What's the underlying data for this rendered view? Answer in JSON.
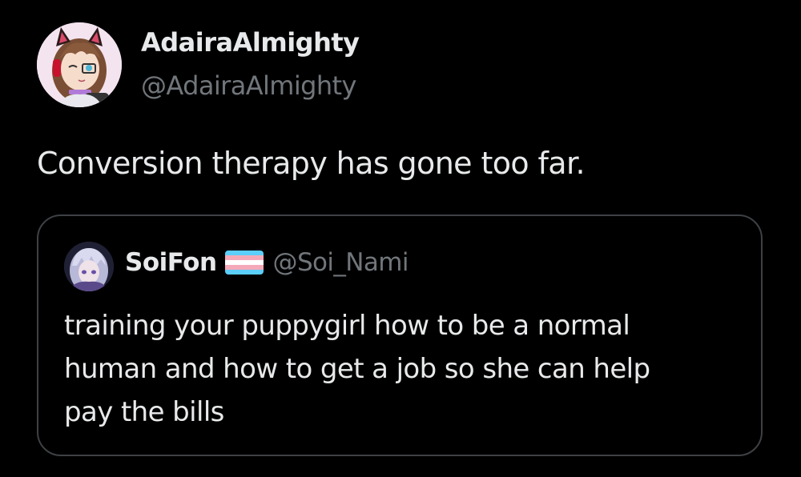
{
  "tweet": {
    "display_name": "AdairaAlmighty",
    "handle": "@AdairaAlmighty",
    "avatar_icon": "anime-girl-avatar-icon",
    "text": "Conversion therapy has gone too far."
  },
  "quote": {
    "display_name": "SoiFon",
    "flag_icon": "transgender-flag-icon",
    "flag_colors": [
      "#5bcefa",
      "#f5a9b8",
      "#ffffff",
      "#f5a9b8",
      "#5bcefa"
    ],
    "handle": "@Soi_Nami",
    "avatar_icon": "anime-character-avatar-icon",
    "text_lines": [
      "training your puppygirl how to be a normal",
      "human and how to get a job so she can help",
      "pay the bills"
    ]
  },
  "colors": {
    "background": "#000000",
    "primary_text": "#e7e9ea",
    "secondary_text": "#71767b",
    "card_border": "#3e4144"
  }
}
